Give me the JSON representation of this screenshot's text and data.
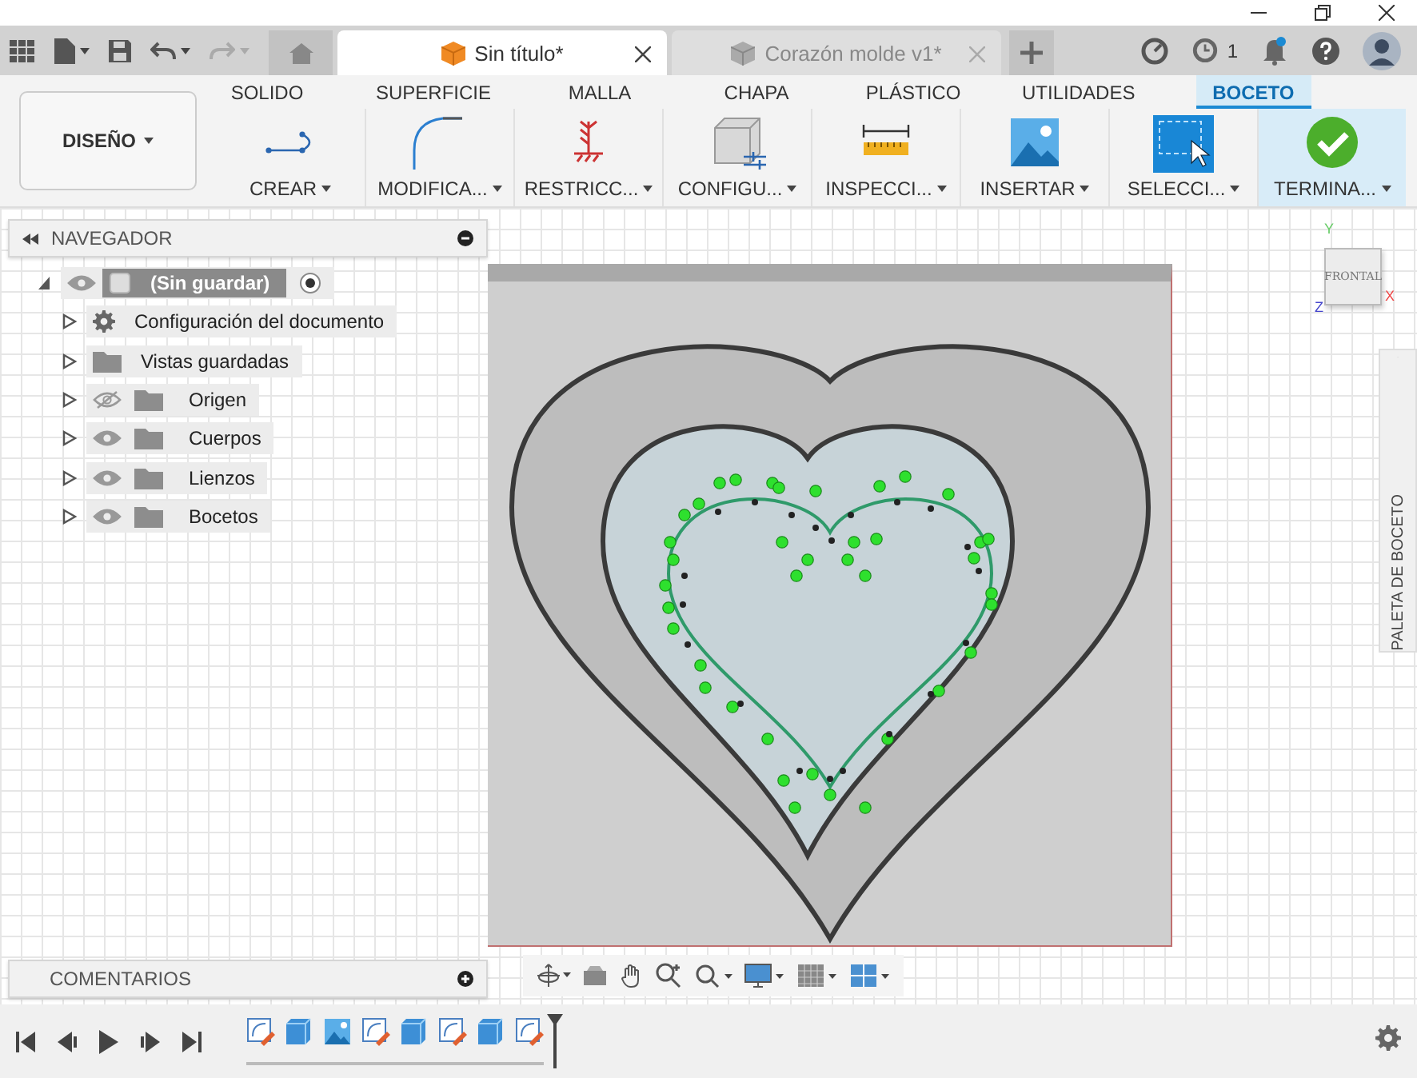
{
  "document_tabs": [
    {
      "label": "Sin título*",
      "selected": true
    },
    {
      "label": "Corazón molde v1*",
      "selected": false
    }
  ],
  "job_count": "1",
  "workspace": {
    "label": "DISEÑO"
  },
  "ribbon_tabs": [
    {
      "label": "SOLIDO",
      "selected": false
    },
    {
      "label": "SUPERFICIE",
      "selected": false
    },
    {
      "label": "MALLA",
      "selected": false
    },
    {
      "label": "CHAPA",
      "selected": false
    },
    {
      "label": "PLÁSTICO",
      "selected": false
    },
    {
      "label": "UTILIDADES",
      "selected": false
    },
    {
      "label": "BOCETO",
      "selected": true
    }
  ],
  "tools": [
    {
      "kind": "create",
      "label": "CREAR"
    },
    {
      "kind": "modify",
      "label": "MODIFICA..."
    },
    {
      "kind": "constrain",
      "label": "RESTRICC..."
    },
    {
      "kind": "configure",
      "label": "CONFIGU..."
    },
    {
      "kind": "inspect",
      "label": "INSPECCI..."
    },
    {
      "kind": "insert",
      "label": "INSERTAR"
    },
    {
      "kind": "select",
      "label": "SELECCI..."
    },
    {
      "kind": "finish",
      "label": "TERMINA..."
    }
  ],
  "navigator": {
    "title": "NAVEGADOR",
    "root": {
      "label": "(Sin guardar)",
      "expanded": true,
      "children": [
        {
          "kind": "settings",
          "label": "Configuración del documento",
          "expanded": false
        },
        {
          "kind": "folder",
          "label": "Vistas guardadas",
          "expanded": false
        },
        {
          "kind": "folder",
          "label": "Origen",
          "expanded": false,
          "visible": false
        },
        {
          "kind": "folder",
          "label": "Cuerpos",
          "expanded": false,
          "visible": true
        },
        {
          "kind": "folder",
          "label": "Lienzos",
          "expanded": false,
          "visible": true
        },
        {
          "kind": "folder",
          "label": "Bocetos",
          "expanded": false,
          "visible": true
        }
      ]
    }
  },
  "view_cube": {
    "face": "FRONTAL",
    "axes": [
      "Y",
      "X",
      "Z"
    ]
  },
  "sketch_palette": {
    "title": "PALETA DE BOCETO"
  },
  "comments": {
    "title": "COMENTARIOS"
  },
  "timeline": {
    "items": [
      {
        "kind": "sketch"
      },
      {
        "kind": "body"
      },
      {
        "kind": "image"
      },
      {
        "kind": "sketch"
      },
      {
        "kind": "body"
      },
      {
        "kind": "sketch"
      },
      {
        "kind": "body"
      },
      {
        "kind": "sketch"
      }
    ]
  }
}
